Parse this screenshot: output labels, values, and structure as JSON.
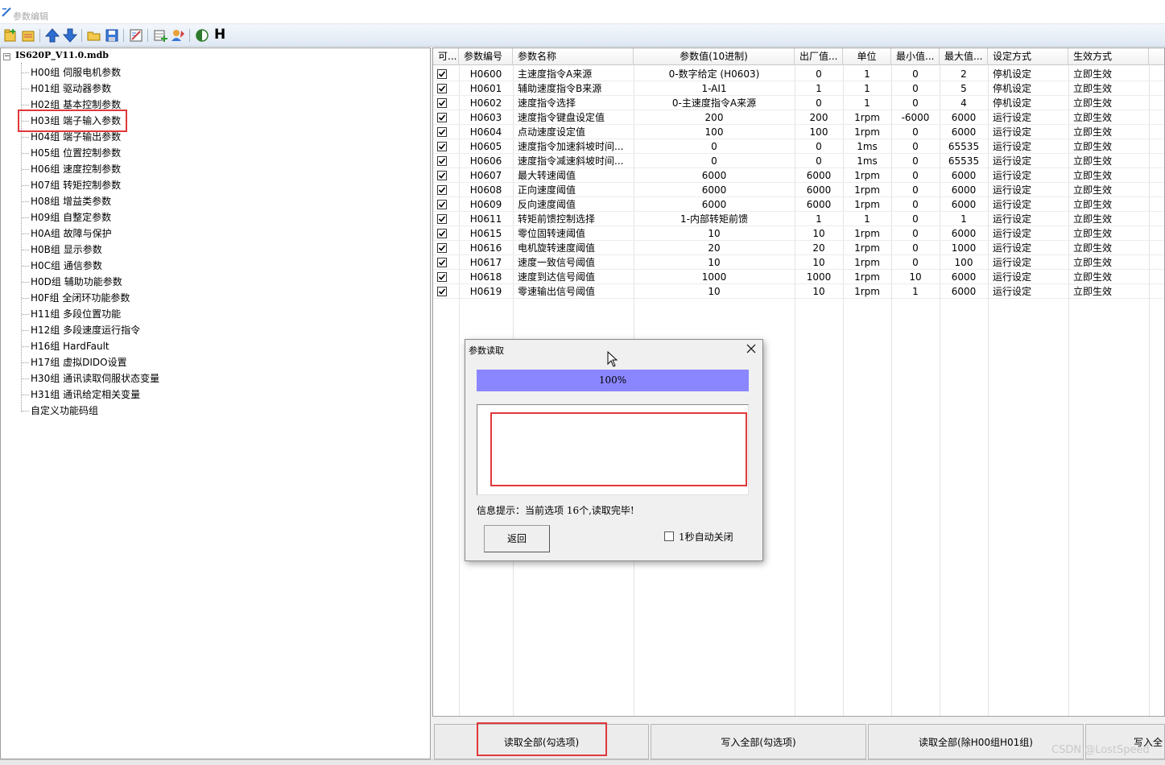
{
  "window": {
    "title": "参数编辑"
  },
  "toolbar": {
    "h_label": "H"
  },
  "tree": {
    "root": "IS620P_V11.0.mdb",
    "items": [
      "H00组 伺服电机参数",
      "H01组 驱动器参数",
      "H02组 基本控制参数",
      "H03组 端子输入参数",
      "H04组 端子输出参数",
      "H05组 位置控制参数",
      "H06组 速度控制参数",
      "H07组 转矩控制参数",
      "H08组 增益类参数",
      "H09组 自整定参数",
      "H0A组 故障与保护",
      "H0B组 显示参数",
      "H0C组 通信参数",
      "H0D组 辅助功能参数",
      "H0F组 全闭环功能参数",
      "H11组 多段位置功能",
      "H12组 多段速度运行指令",
      "H16组 HardFault",
      "H17组 虚拟DIDO设置",
      "H30组 通讯读取伺服状态变量",
      "H31组 通讯给定相关变量",
      "自定义功能码组"
    ],
    "selected_index": 6
  },
  "grid": {
    "headers": [
      "可...",
      "参数编号",
      "参数名称",
      "参数值(10进制)",
      "出厂值...",
      "单位",
      "最小值...",
      "最大值...",
      "设定方式",
      "生效方式"
    ],
    "rows": [
      {
        "code": "H0600",
        "name": "主速度指令A来源",
        "value": "0-数字给定 (H0603)",
        "factory": "0",
        "unit": "1",
        "min": "0",
        "max": "2",
        "set": "停机设定",
        "effect": "立即生效"
      },
      {
        "code": "H0601",
        "name": "辅助速度指令B来源",
        "value": "1-AI1",
        "factory": "1",
        "unit": "1",
        "min": "0",
        "max": "5",
        "set": "停机设定",
        "effect": "立即生效"
      },
      {
        "code": "H0602",
        "name": "速度指令选择",
        "value": "0-主速度指令A来源",
        "factory": "0",
        "unit": "1",
        "min": "0",
        "max": "4",
        "set": "停机设定",
        "effect": "立即生效"
      },
      {
        "code": "H0603",
        "name": "速度指令键盘设定值",
        "value": "200",
        "factory": "200",
        "unit": "1rpm",
        "min": "-6000",
        "max": "6000",
        "set": "运行设定",
        "effect": "立即生效"
      },
      {
        "code": "H0604",
        "name": "点动速度设定值",
        "value": "100",
        "factory": "100",
        "unit": "1rpm",
        "min": "0",
        "max": "6000",
        "set": "运行设定",
        "effect": "立即生效"
      },
      {
        "code": "H0605",
        "name": "速度指令加速斜坡时间...",
        "value": "0",
        "factory": "0",
        "unit": "1ms",
        "min": "0",
        "max": "65535",
        "set": "运行设定",
        "effect": "立即生效"
      },
      {
        "code": "H0606",
        "name": "速度指令减速斜坡时间...",
        "value": "0",
        "factory": "0",
        "unit": "1ms",
        "min": "0",
        "max": "65535",
        "set": "运行设定",
        "effect": "立即生效"
      },
      {
        "code": "H0607",
        "name": "最大转速阈值",
        "value": "6000",
        "factory": "6000",
        "unit": "1rpm",
        "min": "0",
        "max": "6000",
        "set": "运行设定",
        "effect": "立即生效"
      },
      {
        "code": "H0608",
        "name": "正向速度阈值",
        "value": "6000",
        "factory": "6000",
        "unit": "1rpm",
        "min": "0",
        "max": "6000",
        "set": "运行设定",
        "effect": "立即生效"
      },
      {
        "code": "H0609",
        "name": "反向速度阈值",
        "value": "6000",
        "factory": "6000",
        "unit": "1rpm",
        "min": "0",
        "max": "6000",
        "set": "运行设定",
        "effect": "立即生效"
      },
      {
        "code": "H0611",
        "name": "转矩前馈控制选择",
        "value": "1-内部转矩前馈",
        "factory": "1",
        "unit": "1",
        "min": "0",
        "max": "1",
        "set": "运行设定",
        "effect": "立即生效"
      },
      {
        "code": "H0615",
        "name": "零位固转速阈值",
        "value": "10",
        "factory": "10",
        "unit": "1rpm",
        "min": "0",
        "max": "6000",
        "set": "运行设定",
        "effect": "立即生效"
      },
      {
        "code": "H0616",
        "name": "电机旋转速度阈值",
        "value": "20",
        "factory": "20",
        "unit": "1rpm",
        "min": "0",
        "max": "1000",
        "set": "运行设定",
        "effect": "立即生效"
      },
      {
        "code": "H0617",
        "name": "速度一致信号阈值",
        "value": "10",
        "factory": "10",
        "unit": "1rpm",
        "min": "0",
        "max": "100",
        "set": "运行设定",
        "effect": "立即生效"
      },
      {
        "code": "H0618",
        "name": "速度到达信号阈值",
        "value": "1000",
        "factory": "1000",
        "unit": "1rpm",
        "min": "10",
        "max": "6000",
        "set": "运行设定",
        "effect": "立即生效"
      },
      {
        "code": "H0619",
        "name": "零速输出信号阈值",
        "value": "10",
        "factory": "10",
        "unit": "1rpm",
        "min": "1",
        "max": "6000",
        "set": "运行设定",
        "effect": "立即生效"
      }
    ]
  },
  "bottom_buttons": [
    "读取全部(勾选项)",
    "写入全部(勾选项)",
    "读取全部(除H00组H01组)",
    "写入全"
  ],
  "dialog": {
    "title": "参数读取",
    "progress_percent": 100,
    "progress_text": "100%",
    "message_text": "",
    "info": "信息提示：当前选项 16个,读取完毕!",
    "back_button": "返回",
    "auto_close_label": "1秒自动关闭",
    "auto_close_checked": false
  },
  "watermark": "CSDN @LostSpeed",
  "colors": {
    "progress_fill": "#8a86ff",
    "highlight_red": "#e0383b"
  }
}
